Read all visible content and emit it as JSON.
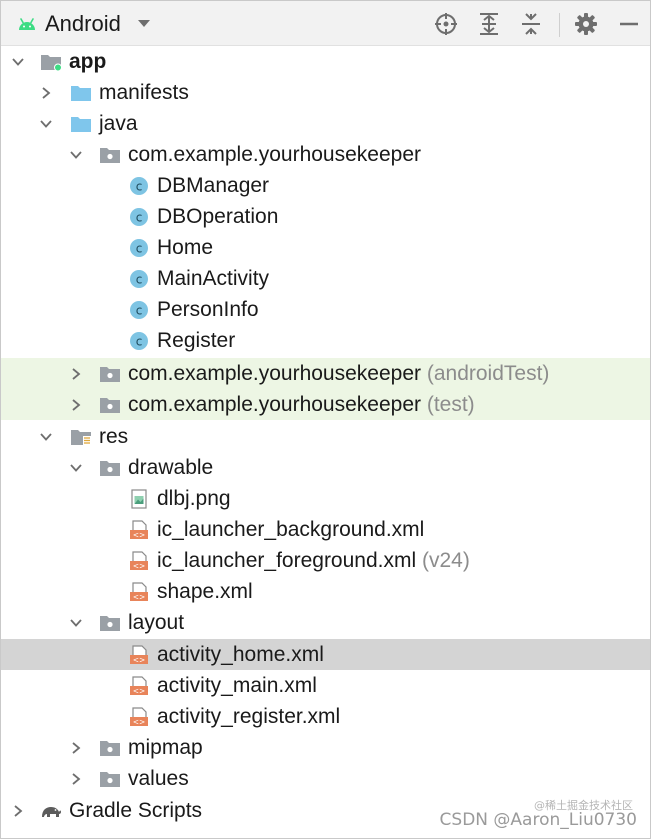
{
  "toolbar": {
    "view_label": "Android",
    "icons": [
      "android-icon",
      "dropdown-arrow-icon",
      "locate-icon",
      "expand-all-icon",
      "collapse-all-icon",
      "gear-icon",
      "minimize-icon"
    ]
  },
  "tree": {
    "app": {
      "label": "app"
    },
    "manifests": {
      "label": "manifests"
    },
    "java": {
      "label": "java"
    },
    "pkg_main": {
      "label": "com.example.yourhousekeeper"
    },
    "classes": {
      "c0": "DBManager",
      "c1": "DBOperation",
      "c2": "Home",
      "c3": "MainActivity",
      "c4": "PersonInfo",
      "c5": "Register"
    },
    "pkg_android_test": {
      "label": "com.example.yourhousekeeper",
      "suffix": "(androidTest)"
    },
    "pkg_test": {
      "label": "com.example.yourhousekeeper",
      "suffix": "(test)"
    },
    "res": {
      "label": "res"
    },
    "drawable": {
      "label": "drawable"
    },
    "dlbj": {
      "label": "dlbj.png"
    },
    "ic_bg": {
      "label": "ic_launcher_background.xml"
    },
    "ic_fg": {
      "label": "ic_launcher_foreground.xml",
      "suffix": "(v24)"
    },
    "shape": {
      "label": "shape.xml"
    },
    "layout": {
      "label": "layout"
    },
    "act_home": {
      "label": "activity_home.xml"
    },
    "act_main": {
      "label": "activity_main.xml"
    },
    "act_register": {
      "label": "activity_register.xml"
    },
    "mipmap": {
      "label": "mipmap"
    },
    "values": {
      "label": "values"
    },
    "gradle": {
      "label": "Gradle Scripts"
    }
  },
  "watermark": {
    "text": "CSDN @Aaron_Liu0730",
    "small": "@稀土掘金技术社区"
  },
  "colors": {
    "toolbar_bg": "#f2f2f2",
    "green_row": "#edf6e4",
    "selected_row": "#d4d4d4",
    "class_icon": "#7ec4e3",
    "folder_blue": "#7fc6ec",
    "folder_gray": "#9aa0a6",
    "xml_orange": "#e8845a",
    "android_green": "#3ddc84"
  }
}
